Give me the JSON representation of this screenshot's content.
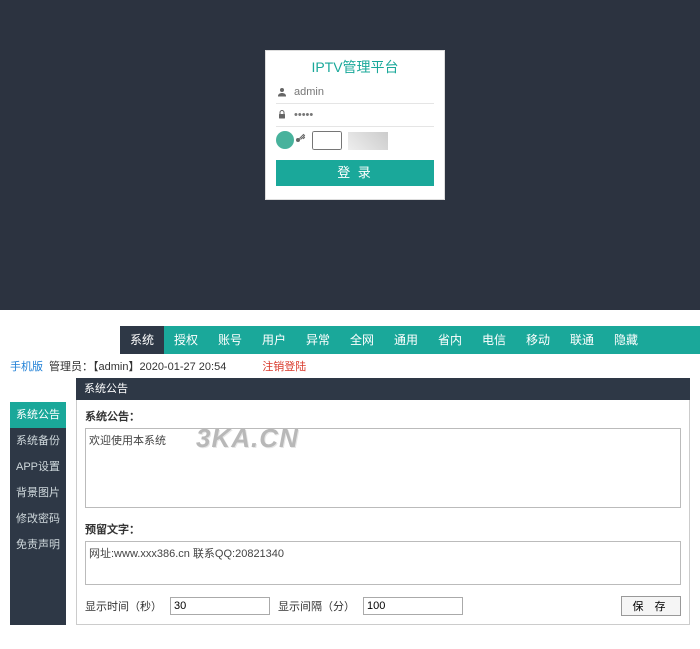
{
  "login": {
    "title": "IPTV管理平台",
    "username": "admin",
    "password_mask": "•••••",
    "captcha_value": "",
    "button": "登 录"
  },
  "nav": {
    "items": [
      "系统",
      "授权",
      "账号",
      "用户",
      "异常",
      "全网",
      "通用",
      "省内",
      "电信",
      "移动",
      "联通",
      "隐藏"
    ],
    "active_index": 0
  },
  "header": {
    "mobile_link": "手机版",
    "admin_label": "管理员：【admin】2020-01-27 20:54",
    "logout": "注销登陆"
  },
  "sidebar": {
    "items": [
      "系统公告",
      "系统备份",
      "APP设置",
      "背景图片",
      "修改密码",
      "免责声明"
    ],
    "active_index": 0
  },
  "panel": {
    "title": "系统公告",
    "notice_label": "系统公告：",
    "notice_value": "欢迎使用本系统",
    "reserve_label": "预留文字：",
    "reserve_value": "网址:www.xxx386.cn 联系QQ:20821340",
    "display_time_label": "显示时间（秒）",
    "display_time_value": "30",
    "display_gap_label": "显示间隔（分）",
    "display_gap_value": "100",
    "save": "保 存"
  },
  "watermark": "3KA.CN"
}
